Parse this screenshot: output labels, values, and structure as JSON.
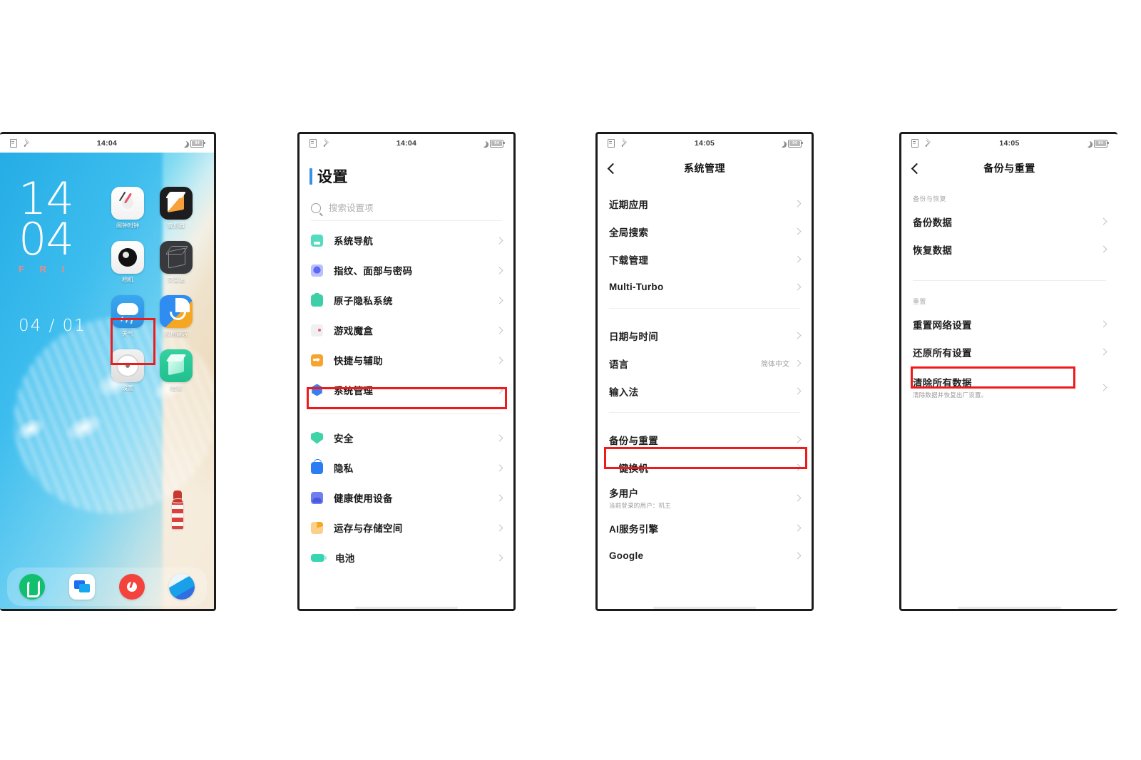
{
  "colors": {
    "highlight": "#ef1b1b",
    "accent_blue": "#3a8fe6",
    "text_primary": "#1b1b1b",
    "text_muted": "#a4a4a4"
  },
  "screens": [
    {
      "id": "home-screen",
      "status": {
        "time": "14:04",
        "battery": "94",
        "left_icons": [
          "sim-icon",
          "wifi-icon"
        ],
        "right_icons": [
          "moon-icon",
          "battery-icon"
        ]
      },
      "clock_widget": {
        "hours": "14",
        "minutes": "04",
        "weekday": "F R I",
        "date": "04 / 01"
      },
      "apps": [
        {
          "label": "闹钟时钟",
          "icon": "alarm-clock-icon"
        },
        {
          "label": "变形器",
          "icon": "transformer-icon"
        },
        {
          "label": "相机",
          "icon": "camera-icon"
        },
        {
          "label": "交互油",
          "icon": "interactive-icon"
        },
        {
          "label": "天气",
          "icon": "weather-icon"
        },
        {
          "label": "应用商店",
          "icon": "app-store-icon"
        },
        {
          "label": "设置",
          "icon": "settings-gear-icon"
        },
        {
          "label": "i管家",
          "icon": "imanager-icon"
        }
      ],
      "dock": [
        {
          "name": "phone-icon"
        },
        {
          "name": "messages-icon"
        },
        {
          "name": "music-icon"
        },
        {
          "name": "browser-icon"
        }
      ],
      "highlight_target": "设置"
    },
    {
      "id": "settings-screen",
      "status": {
        "time": "14:04",
        "battery": "94"
      },
      "title": "设置",
      "search": {
        "placeholder": "搜索设置项",
        "value": "",
        "icon": "search-icon"
      },
      "groups": [
        {
          "items": [
            {
              "label": "系统导航",
              "icon": "navigation-icon",
              "highlight": false
            },
            {
              "label": "指纹、面部与密码",
              "icon": "fingerprint-icon",
              "highlight": false
            },
            {
              "label": "原子隐私系统",
              "icon": "atomic-privacy-icon",
              "highlight": false
            },
            {
              "label": "游戏魔盒",
              "icon": "game-box-icon",
              "highlight": false
            },
            {
              "label": "快捷与辅助",
              "icon": "shortcut-icon",
              "highlight": false
            },
            {
              "label": "系统管理",
              "icon": "system-manage-icon",
              "highlight": true
            }
          ]
        },
        {
          "items": [
            {
              "label": "安全",
              "icon": "security-shield-icon",
              "highlight": false
            },
            {
              "label": "隐私",
              "icon": "privacy-lock-icon",
              "highlight": false
            },
            {
              "label": "健康使用设备",
              "icon": "digital-wellbeing-icon",
              "highlight": false
            },
            {
              "label": "运存与存储空间",
              "icon": "storage-icon",
              "highlight": false
            },
            {
              "label": "电池",
              "icon": "battery-icon",
              "highlight": false
            }
          ]
        }
      ]
    },
    {
      "id": "system-management-screen",
      "status": {
        "time": "14:05",
        "battery": "94"
      },
      "nav": {
        "back": "back-arrow-icon",
        "title": "系统管理"
      },
      "groups": [
        {
          "items": [
            {
              "label": "近期应用",
              "value": "",
              "sub": "",
              "highlight": false
            },
            {
              "label": "全局搜索",
              "value": "",
              "sub": "",
              "highlight": false
            },
            {
              "label": "下载管理",
              "value": "",
              "sub": "",
              "highlight": false
            },
            {
              "label": "Multi-Turbo",
              "value": "",
              "sub": "",
              "highlight": false
            }
          ]
        },
        {
          "items": [
            {
              "label": "日期与时间",
              "value": "",
              "sub": "",
              "highlight": false
            },
            {
              "label": "语言",
              "value": "简体中文",
              "sub": "",
              "highlight": false
            },
            {
              "label": "输入法",
              "value": "",
              "sub": "",
              "highlight": false
            }
          ]
        },
        {
          "items": [
            {
              "label": "备份与重置",
              "value": "",
              "sub": "",
              "highlight": true
            },
            {
              "label": "一键换机",
              "value": "",
              "sub": "",
              "highlight": false
            },
            {
              "label": "多用户",
              "value": "",
              "sub": "当前登录的用户：机主",
              "highlight": false
            },
            {
              "label": "AI服务引擎",
              "value": "",
              "sub": "",
              "highlight": false
            },
            {
              "label": "Google",
              "value": "",
              "sub": "",
              "highlight": false
            }
          ]
        }
      ]
    },
    {
      "id": "backup-reset-screen",
      "status": {
        "time": "14:05",
        "battery": "94"
      },
      "nav": {
        "back": "back-arrow-icon",
        "title": "备份与重置"
      },
      "sections": [
        {
          "header": "备份与恢复",
          "items": [
            {
              "label": "备份数据",
              "sub": "",
              "highlight": false
            },
            {
              "label": "恢复数据",
              "sub": "",
              "highlight": false
            }
          ]
        },
        {
          "header": "重置",
          "items": [
            {
              "label": "重置网络设置",
              "sub": "",
              "highlight": false
            },
            {
              "label": "还原所有设置",
              "sub": "",
              "highlight": true
            },
            {
              "label": "清除所有数据",
              "sub": "清除数据并恢复出厂设置。",
              "highlight": false
            }
          ]
        }
      ]
    }
  ]
}
